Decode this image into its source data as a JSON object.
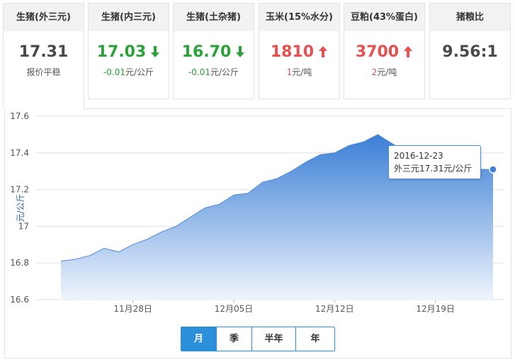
{
  "cards": [
    {
      "title": "生猪(外三元)",
      "price": "17.31",
      "sub_change": "",
      "sub_unit": "报价平稳",
      "trend": "flat",
      "active": true
    },
    {
      "title": "生猪(内三元)",
      "price": "17.03",
      "sub_change": "-0.01",
      "sub_unit": "元/公斤",
      "trend": "down",
      "active": false
    },
    {
      "title": "生猪(土杂猪)",
      "price": "16.70",
      "sub_change": "-0.01",
      "sub_unit": "元/公斤",
      "trend": "down",
      "active": false
    },
    {
      "title": "玉米(15%水分)",
      "price": "1810",
      "sub_change": "1",
      "sub_unit": "元/吨",
      "trend": "up",
      "active": false
    },
    {
      "title": "豆粕(43%蛋白)",
      "price": "3700",
      "sub_change": "2",
      "sub_unit": "元/吨",
      "trend": "up",
      "active": false
    },
    {
      "title": "猪粮比",
      "price": "9.56:1",
      "sub_change": "",
      "sub_unit": "",
      "trend": "flat",
      "active": false
    }
  ],
  "colors": {
    "up": "#e94f4f",
    "down": "#2aa23a",
    "accent": "#2b8fd9",
    "area_top": "#3b7fd6",
    "area_bottom": "#eef4fc",
    "line": "#4a88d8"
  },
  "range_tabs": [
    {
      "label": "月",
      "active": true
    },
    {
      "label": "季",
      "active": false
    },
    {
      "label": "半年",
      "active": false
    },
    {
      "label": "年",
      "active": false
    }
  ],
  "tooltip": {
    "date": "2016-12-23",
    "text": "外三元17.31元/公斤"
  },
  "chart_data": {
    "type": "area",
    "ylabel": "元/公斤",
    "ylim": [
      16.6,
      17.6
    ],
    "yticks": [
      16.6,
      16.8,
      17,
      17.2,
      17.4,
      17.6
    ],
    "yticklabels": [
      "16.6",
      "16.8",
      "17",
      "17.2",
      "17.4",
      "17.6"
    ],
    "x": [
      "2016-11-23",
      "2016-11-24",
      "2016-11-25",
      "2016-11-26",
      "2016-11-27",
      "2016-11-28",
      "2016-11-29",
      "2016-11-30",
      "2016-12-01",
      "2016-12-02",
      "2016-12-03",
      "2016-12-04",
      "2016-12-05",
      "2016-12-06",
      "2016-12-07",
      "2016-12-08",
      "2016-12-09",
      "2016-12-10",
      "2016-12-11",
      "2016-12-12",
      "2016-12-13",
      "2016-12-14",
      "2016-12-15",
      "2016-12-16",
      "2016-12-17",
      "2016-12-18",
      "2016-12-19",
      "2016-12-20",
      "2016-12-21",
      "2016-12-22",
      "2016-12-23"
    ],
    "xticks": [
      "2016-11-28",
      "2016-12-05",
      "2016-12-12",
      "2016-12-19"
    ],
    "xticklabels": [
      "11月28日",
      "12月05日",
      "12月12日",
      "12月19日"
    ],
    "values": [
      16.81,
      16.82,
      16.84,
      16.88,
      16.86,
      16.9,
      16.93,
      16.97,
      17.0,
      17.05,
      17.1,
      17.12,
      17.17,
      17.18,
      17.24,
      17.26,
      17.3,
      17.35,
      17.39,
      17.4,
      17.44,
      17.46,
      17.5,
      17.45,
      17.4,
      17.36,
      17.33,
      17.32,
      17.31,
      17.31,
      17.31
    ],
    "highlight_index": 30,
    "grid": true
  }
}
